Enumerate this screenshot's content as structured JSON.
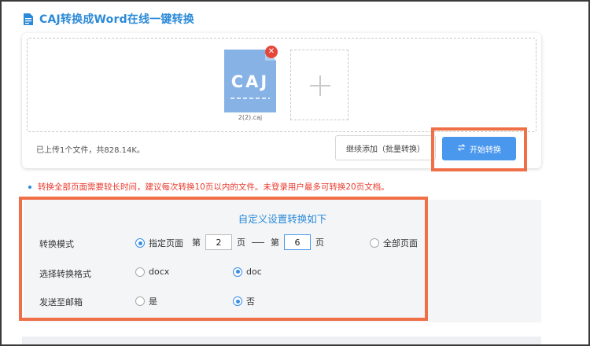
{
  "header": {
    "title": "CAJ转换成Word在线一键转换"
  },
  "upload": {
    "file": {
      "type_label": "CAJ",
      "name": "2(2).caj"
    },
    "summary": "已上传1个文件，共828.14K。",
    "continue_button": "继续添加（批量转换）",
    "start_button": "开始转换"
  },
  "notice": "转换全部页面需要较长时间，建议每次转换10页以内的文件。未登录用户最多可转换20页文档。",
  "settings": {
    "title": "自定义设置转换如下",
    "mode": {
      "label": "转换模式",
      "specified_label": "指定页面",
      "page_prefix": "第",
      "page_suffix": "页",
      "from_value": "2",
      "to_value": "6",
      "all_label": "全部页面",
      "selected": "specified"
    },
    "format": {
      "label": "选择转换格式",
      "options": [
        "docx",
        "doc"
      ],
      "selected": "doc"
    },
    "email": {
      "label": "发送至邮箱",
      "options": [
        "是",
        "否"
      ],
      "selected": "否"
    }
  },
  "colors": {
    "accent": "#2b8ad8",
    "button_primary": "#4a98ee",
    "file_tile": "#86b2e6",
    "notice": "#e8392c",
    "highlight": "#ef6f47"
  }
}
